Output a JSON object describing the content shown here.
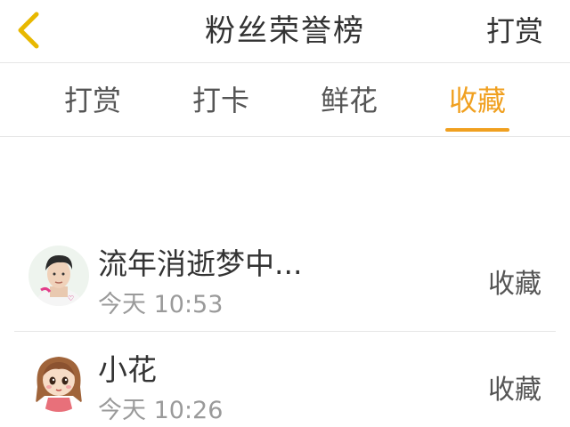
{
  "header": {
    "title": "粉丝荣誉榜",
    "right_action": "打赏",
    "back_icon": "chevron-left-icon",
    "back_icon_color": "#e8b800"
  },
  "tabs": [
    {
      "label": "打赏",
      "active": false
    },
    {
      "label": "打卡",
      "active": false
    },
    {
      "label": "鲜花",
      "active": false
    },
    {
      "label": "收藏",
      "active": true
    }
  ],
  "accent_color": "#f0a020",
  "list": [
    {
      "name": "流年消逝梦中...",
      "time": "今天 10:53",
      "action": "收藏",
      "avatar": "avatar-young-man"
    },
    {
      "name": "小花",
      "time": "今天 10:26",
      "action": "收藏",
      "avatar": "avatar-cartoon-girl"
    }
  ]
}
